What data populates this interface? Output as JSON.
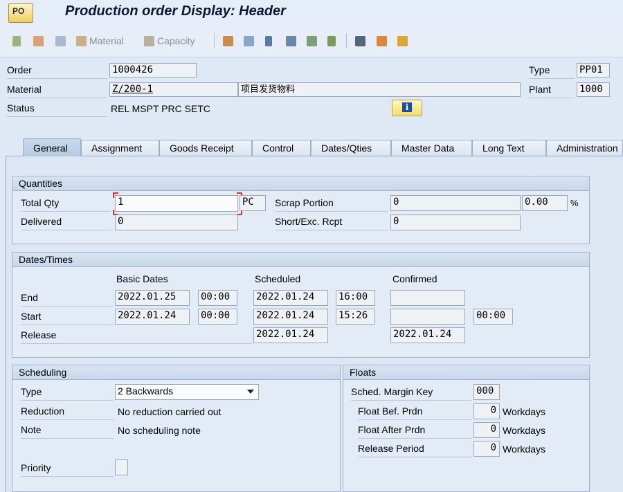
{
  "window": {
    "app_icon_text": "PO",
    "title": "Production order Display: Header"
  },
  "toolbar": {
    "material_label": "Material",
    "capacity_label": "Capacity"
  },
  "header": {
    "order_label": "Order",
    "order_value": "1000426",
    "material_label": "Material",
    "material_value": "Z/200-1",
    "material_description": "项目发货物料",
    "status_label": "Status",
    "status_value": "REL  MSPT PRC  SETC",
    "type_label": "Type",
    "type_value": "PP01",
    "plant_label": "Plant",
    "plant_value": "1000"
  },
  "tabs": [
    {
      "label": "General",
      "active": true
    },
    {
      "label": "Assignment"
    },
    {
      "label": "Goods Receipt"
    },
    {
      "label": "Control"
    },
    {
      "label": "Dates/Qties"
    },
    {
      "label": "Master Data"
    },
    {
      "label": "Long Text"
    },
    {
      "label": "Administration"
    }
  ],
  "quantities": {
    "title": "Quantities",
    "total_qty_label": "Total Qty",
    "total_qty_value": "1",
    "unit": "PC",
    "scrap_portion_label": "Scrap Portion",
    "scrap_portion_value": "0",
    "scrap_percent_value": "0.00",
    "percent_sign": "%",
    "delivered_label": "Delivered",
    "delivered_value": "0",
    "short_exc_label": "Short/Exc. Rcpt",
    "short_exc_value": "0"
  },
  "dates": {
    "title": "Dates/Times",
    "col_basic": "Basic Dates",
    "col_scheduled": "Scheduled",
    "col_confirmed": "Confirmed",
    "end_label": "End",
    "start_label": "Start",
    "release_label": "Release",
    "end_basic_date": "2022.01.25",
    "end_basic_time": "00:00",
    "end_sched_date": "2022.01.24",
    "end_sched_time": "16:00",
    "end_conf_date": "",
    "start_basic_date": "2022.01.24",
    "start_basic_time": "00:00",
    "start_sched_date": "2022.01.24",
    "start_sched_time": "15:26",
    "start_conf_date": "",
    "start_conf_time": "00:00",
    "release_sched_date": "2022.01.24",
    "release_conf_date": "2022.01.24"
  },
  "scheduling": {
    "title": "Scheduling",
    "type_label": "Type",
    "type_value": "2 Backwards",
    "reduction_label": "Reduction",
    "reduction_value": "No reduction carried out",
    "note_label": "Note",
    "note_value": "No scheduling note",
    "priority_label": "Priority",
    "priority_value": ""
  },
  "floats": {
    "title": "Floats",
    "margin_key_label": "Sched. Margin Key",
    "margin_key_value": "000",
    "float_before_label": "Float Bef. Prdn",
    "float_before_value": "0",
    "float_after_label": "Float After Prdn",
    "float_after_value": "0",
    "release_period_label": "Release Period",
    "release_period_value": "0",
    "unit": "Workdays"
  }
}
